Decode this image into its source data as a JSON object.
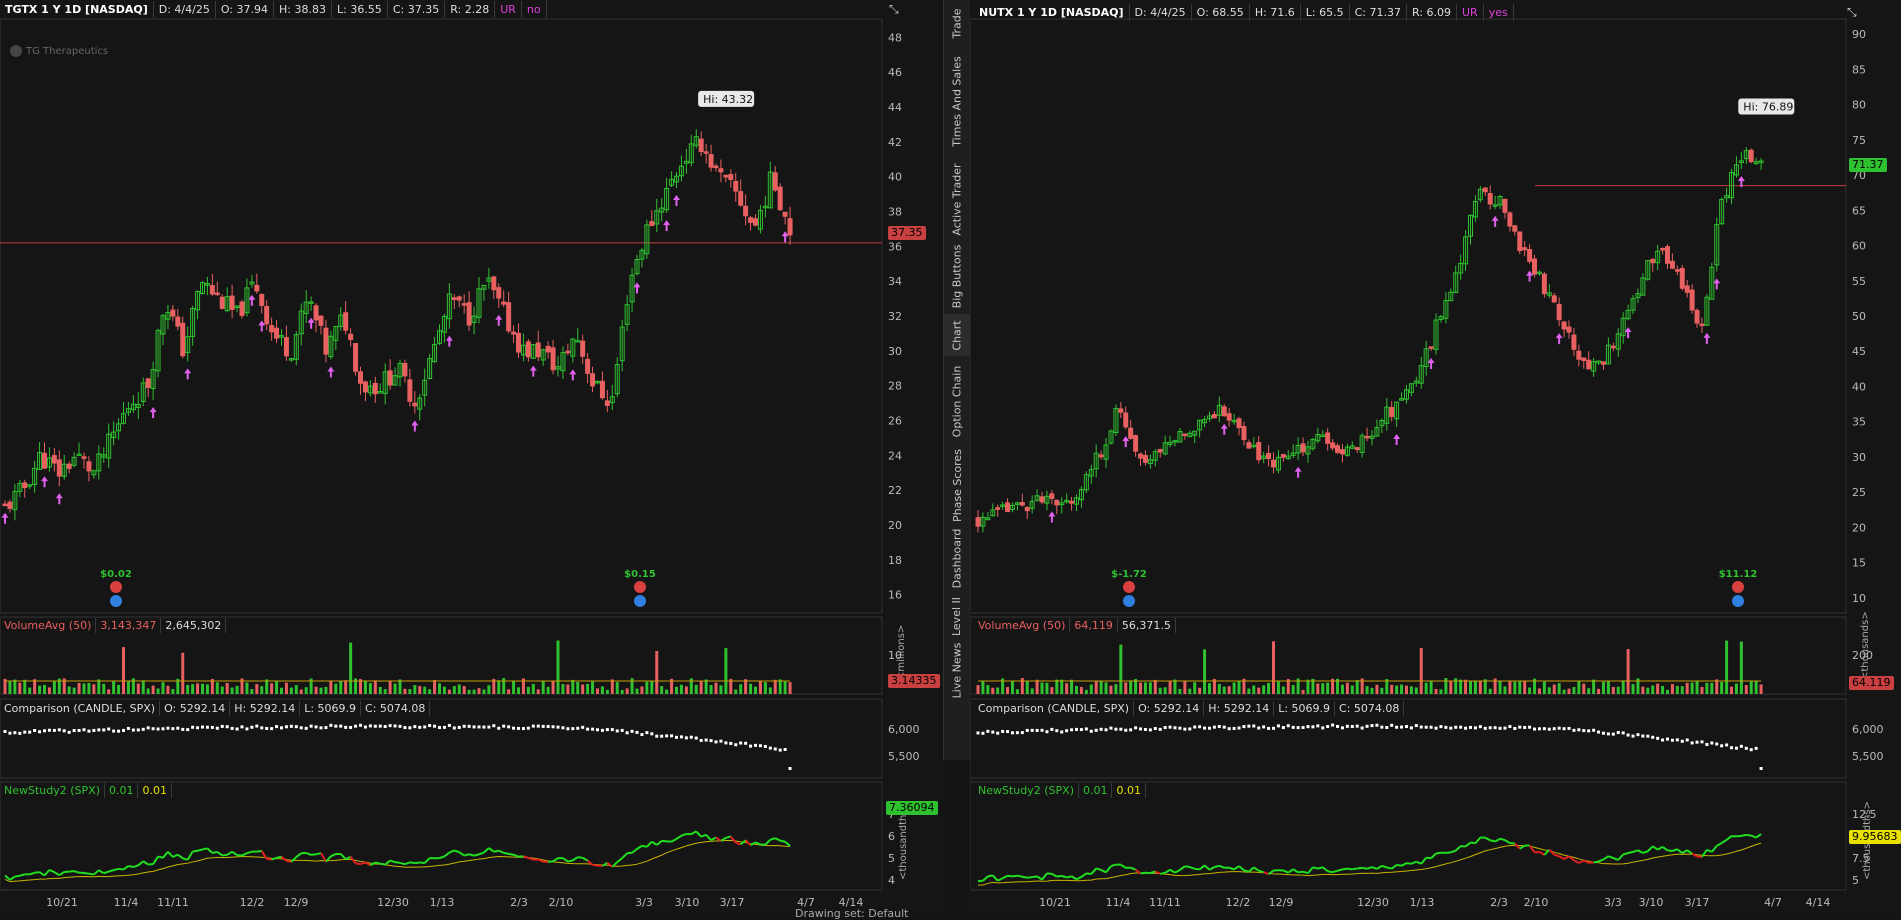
{
  "tabs": [
    "Trade",
    "Times And Sales",
    "Active Trader",
    "Big Buttons",
    "Chart",
    "Option Chain",
    "Phase Scores",
    "Dashboard",
    "Level II",
    "Live News"
  ],
  "active_tab": "Chart",
  "left": {
    "header": {
      "symbol": "TGTX 1 Y 1D [NASDAQ]",
      "d": "D: 4/4/25",
      "o": "O: 37.94",
      "h": "H: 38.83",
      "l": "L: 36.55",
      "c": "C: 37.35",
      "r": "R: 2.28",
      "ur": "UR",
      "flag": "no"
    },
    "company": "TG Therapeutics",
    "hi_label": "Hi: 43.32",
    "price_badge": "37.35",
    "y_ticks": [
      "48",
      "46",
      "44",
      "42",
      "40",
      "38",
      "36",
      "34",
      "32",
      "30",
      "28",
      "26",
      "24",
      "22",
      "20",
      "18",
      "16"
    ],
    "earnings": [
      "$0.02",
      "$0.15"
    ],
    "volume": {
      "label": "VolumeAvg (50)",
      "v1": "3,143,347",
      "v2": "2,645,302",
      "ticks": [
        "10",
        "5"
      ],
      "unit": "<millions>",
      "badge": "3.14335"
    },
    "comparison": {
      "label": "Comparison (CANDLE, SPX)",
      "o": "O: 5292.14",
      "h": "H: 5292.14",
      "l": "L: 5069.9",
      "c": "C: 5074.08",
      "ticks": [
        "6,000",
        "5,500"
      ]
    },
    "study": {
      "label": "NewStudy2 (SPX)",
      "v1": "0.01",
      "v2": "0.01",
      "ticks": [
        "7",
        "6",
        "5",
        "4"
      ],
      "unit": "<thousandths>",
      "badge": "7.36094"
    },
    "x_ticks": [
      "10/21",
      "11/4",
      "11/11",
      "12/2",
      "12/9",
      "12/30",
      "1/13",
      "2/3",
      "2/10",
      "3/3",
      "3/10",
      "3/17",
      "4/7",
      "4/14"
    ],
    "footer": "Drawing set: Default"
  },
  "right": {
    "header": {
      "symbol": "NUTX 1 Y 1D [NASDAQ]",
      "d": "D: 4/4/25",
      "o": "O: 68.55",
      "h": "H: 71.6",
      "l": "L: 65.5",
      "c": "C: 71.37",
      "r": "R: 6.09",
      "ur": "UR",
      "flag": "yes"
    },
    "hi_label": "Hi: 76.89",
    "price_badge": "71.37",
    "y_ticks": [
      "90",
      "85",
      "80",
      "75",
      "70",
      "65",
      "60",
      "55",
      "50",
      "45",
      "40",
      "35",
      "30",
      "25",
      "20",
      "15",
      "10"
    ],
    "earnings": [
      "$-1.72",
      "$11.12"
    ],
    "volume": {
      "label": "VolumeAvg (50)",
      "v1": "64,119",
      "v2": "56,371.5",
      "ticks": [
        "200",
        "100"
      ],
      "unit": "<thousands>",
      "badge": "64.119"
    },
    "comparison": {
      "label": "Comparison (CANDLE, SPX)",
      "o": "O: 5292.14",
      "h": "H: 5292.14",
      "l": "L: 5069.9",
      "c": "C: 5074.08",
      "ticks": [
        "6,000",
        "5,500"
      ]
    },
    "study": {
      "label": "NewStudy2 (SPX)",
      "v1": "0.01",
      "v2": "0.01",
      "ticks": [
        "12.5",
        "10",
        "7.5",
        "5"
      ],
      "unit": "<thousandths>",
      "badge": "9.95683"
    },
    "x_ticks": [
      "10/21",
      "11/4",
      "11/11",
      "12/2",
      "12/9",
      "12/30",
      "1/13",
      "2/3",
      "2/10",
      "3/3",
      "3/10",
      "3/17",
      "4/7",
      "4/14"
    ]
  },
  "colors": {
    "up": "#2fc12f",
    "down": "#e86060",
    "hline": "#c04040",
    "arrow": "#e060f0",
    "vol_avg": "#c8a000",
    "study_line": "#c8b400",
    "bg": "#151515"
  },
  "chart_data": [
    {
      "type": "candlestick",
      "title": "TGTX 1 Y 1D [NASDAQ]",
      "ylim": [
        15,
        49
      ],
      "key_points": {
        "start": 21,
        "high": 43.32,
        "last_close": 37.35,
        "resistance": 36.2
      },
      "close_path": [
        21,
        22,
        24,
        23,
        24,
        23,
        25,
        27,
        28,
        33,
        30,
        34,
        33,
        32,
        34,
        31,
        30,
        33,
        30,
        32,
        28,
        28,
        29,
        27,
        30,
        33,
        32,
        34,
        32,
        30,
        30,
        29,
        31,
        28,
        27,
        34,
        37,
        39,
        41,
        42,
        40,
        39,
        37,
        40,
        37
      ]
    },
    {
      "type": "candlestick",
      "title": "NUTX 1 Y 1D [NASDAQ]",
      "ylim": [
        8,
        92
      ],
      "key_points": {
        "start": 22,
        "high": 76.89,
        "last_close": 71.37,
        "resistance": 68.5
      },
      "close_path": [
        21,
        22,
        23,
        24,
        23,
        25,
        30,
        37,
        29,
        31,
        33,
        35,
        37,
        34,
        30,
        29,
        31,
        33,
        30,
        32,
        35,
        38,
        42,
        50,
        58,
        68,
        66,
        60,
        55,
        50,
        44,
        43,
        48,
        55,
        60,
        55,
        48,
        66,
        73,
        71
      ]
    }
  ]
}
